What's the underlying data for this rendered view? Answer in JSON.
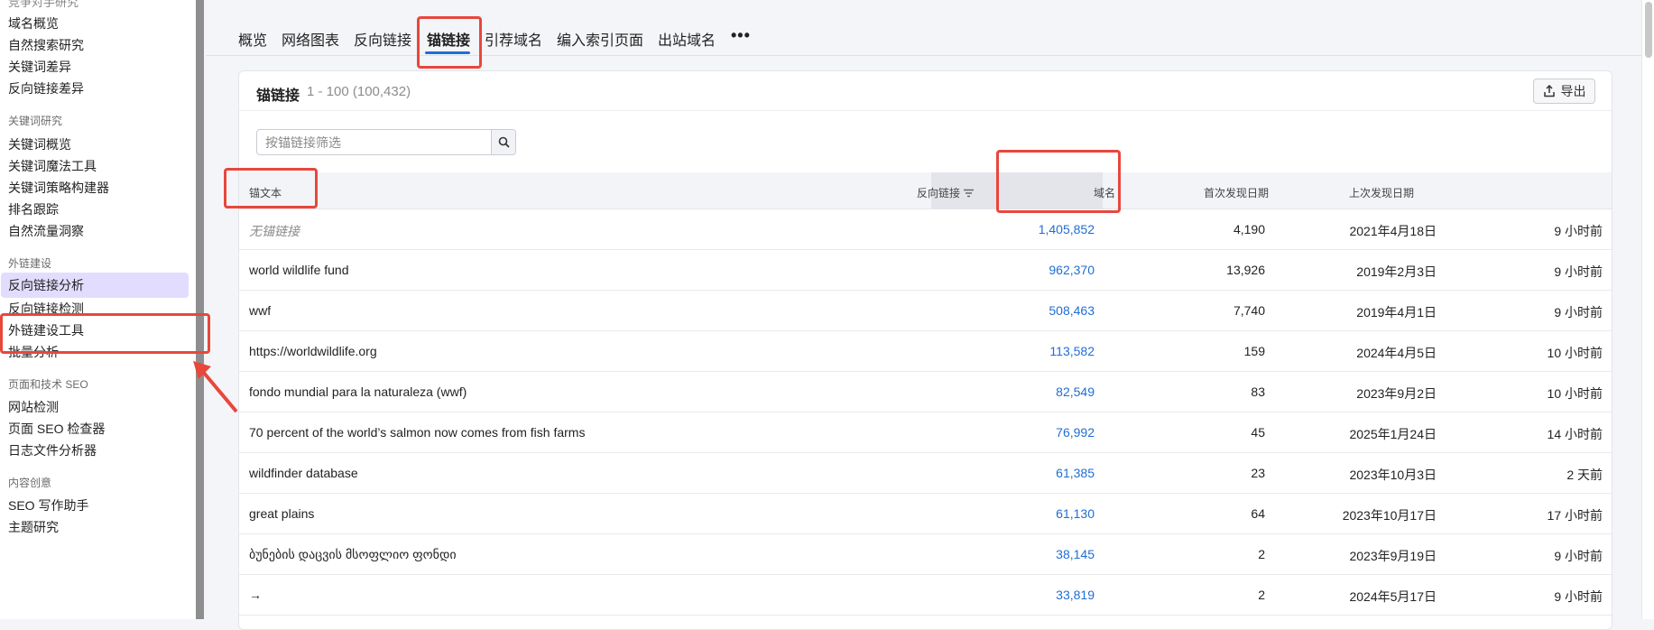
{
  "sidebar": {
    "partial_top": "竞争对手研究",
    "sections": [
      {
        "title": "",
        "items": [
          "域名概览",
          "自然搜索研究",
          "关键词差异",
          "反向链接差异"
        ]
      },
      {
        "title": "关键词研究",
        "items": [
          "关键词概览",
          "关键词魔法工具",
          "关键词策略构建器",
          "排名跟踪",
          "自然流量洞察"
        ]
      },
      {
        "title": "外链建设",
        "items": [
          "反向链接分析",
          "反向链接检测",
          "外链建设工具",
          "批量分析"
        ]
      },
      {
        "title": "页面和技术 SEO",
        "items": [
          "网站检测",
          "页面 SEO 检查器",
          "日志文件分析器"
        ]
      },
      {
        "title": "内容创意",
        "items": [
          "SEO 写作助手",
          "主题研究"
        ]
      }
    ],
    "active_item": "反向链接分析"
  },
  "tabs": [
    "概览",
    "网络图表",
    "反向链接",
    "锚链接",
    "引荐域名",
    "编入索引页面",
    "出站域名"
  ],
  "active_tab": "锚链接",
  "card": {
    "title": "锚链接",
    "range": "1 - 100 (100,432)",
    "export_label": "导出"
  },
  "filter": {
    "placeholder": "按锚链接筛选"
  },
  "table": {
    "columns": [
      "锚文本",
      "反向链接",
      "域名",
      "首次发现日期",
      "上次发现日期"
    ],
    "sorted_column": "反向链接",
    "rows": [
      {
        "anchor": "无锚链接",
        "backlinks": "1,405,852",
        "domains": "4,190",
        "first_seen": "2021年4月18日",
        "last_seen": "9 小时前"
      },
      {
        "anchor": "world wildlife fund",
        "backlinks": "962,370",
        "domains": "13,926",
        "first_seen": "2019年2月3日",
        "last_seen": "9 小时前"
      },
      {
        "anchor": "wwf",
        "backlinks": "508,463",
        "domains": "7,740",
        "first_seen": "2019年4月1日",
        "last_seen": "9 小时前"
      },
      {
        "anchor": "https://worldwildlife.org",
        "backlinks": "113,582",
        "domains": "159",
        "first_seen": "2024年4月5日",
        "last_seen": "10 小时前"
      },
      {
        "anchor": "fondo mundial para la naturaleza (wwf)",
        "backlinks": "82,549",
        "domains": "83",
        "first_seen": "2023年9月2日",
        "last_seen": "10 小时前"
      },
      {
        "anchor": "70 percent of the world’s salmon now comes from fish farms",
        "backlinks": "76,992",
        "domains": "45",
        "first_seen": "2025年1月24日",
        "last_seen": "14 小时前"
      },
      {
        "anchor": "wildfinder database",
        "backlinks": "61,385",
        "domains": "23",
        "first_seen": "2023年10月3日",
        "last_seen": "2 天前"
      },
      {
        "anchor": "great plains",
        "backlinks": "61,130",
        "domains": "64",
        "first_seen": "2023年10月17日",
        "last_seen": "17 小时前"
      },
      {
        "anchor": "ბუნების დაცვის მსოფლიო ფონდი",
        "backlinks": "38,145",
        "domains": "2",
        "first_seen": "2023年9月19日",
        "last_seen": "9 小时前"
      },
      {
        "anchor": "→",
        "backlinks": "33,819",
        "domains": "2",
        "first_seen": "2024年5月17日",
        "last_seen": "9 小时前"
      }
    ]
  },
  "colors": {
    "accent": "#1f6ed4",
    "annotation": "#e8473c",
    "active_bg": "#e2ddff"
  }
}
